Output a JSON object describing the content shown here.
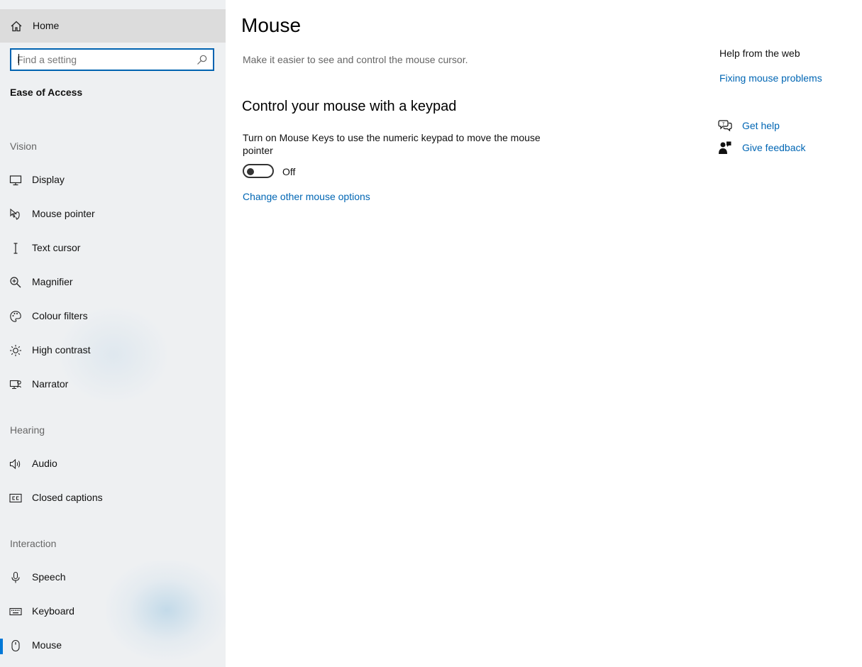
{
  "sidebar": {
    "home_label": "Home",
    "search": {
      "placeholder": "Find a setting",
      "value": ""
    },
    "section_title": "Ease of Access",
    "groups": {
      "vision": "Vision",
      "hearing": "Hearing",
      "interaction": "Interaction"
    },
    "items": [
      {
        "label": "Display",
        "icon": "display-icon"
      },
      {
        "label": "Mouse pointer",
        "icon": "mouse-pointer-icon"
      },
      {
        "label": "Text cursor",
        "icon": "text-cursor-icon"
      },
      {
        "label": "Magnifier",
        "icon": "magnifier-icon"
      },
      {
        "label": "Colour filters",
        "icon": "palette-icon"
      },
      {
        "label": "High contrast",
        "icon": "sun-icon"
      },
      {
        "label": "Narrator",
        "icon": "narrator-icon"
      },
      {
        "label": "Audio",
        "icon": "speaker-icon"
      },
      {
        "label": "Closed captions",
        "icon": "closed-captions-icon"
      },
      {
        "label": "Speech",
        "icon": "microphone-icon"
      },
      {
        "label": "Keyboard",
        "icon": "keyboard-icon"
      },
      {
        "label": "Mouse",
        "icon": "mouse-icon",
        "selected": true
      }
    ]
  },
  "main": {
    "title": "Mouse",
    "subtitle": "Make it easier to see and control the mouse cursor.",
    "section_heading": "Control your mouse with a keypad",
    "mouse_keys_description": "Turn on Mouse Keys to use the numeric keypad to move the mouse pointer",
    "mouse_keys_toggle_state": "Off",
    "other_options_link": "Change other mouse options"
  },
  "help": {
    "title": "Help from the web",
    "web_link": "Fixing mouse problems",
    "get_help": "Get help",
    "give_feedback": "Give feedback"
  },
  "colors": {
    "accent": "#0078d7",
    "link": "#0066b4",
    "sidebar_bg": "#eef0f2",
    "selected_bg": "#dcdcdc"
  }
}
